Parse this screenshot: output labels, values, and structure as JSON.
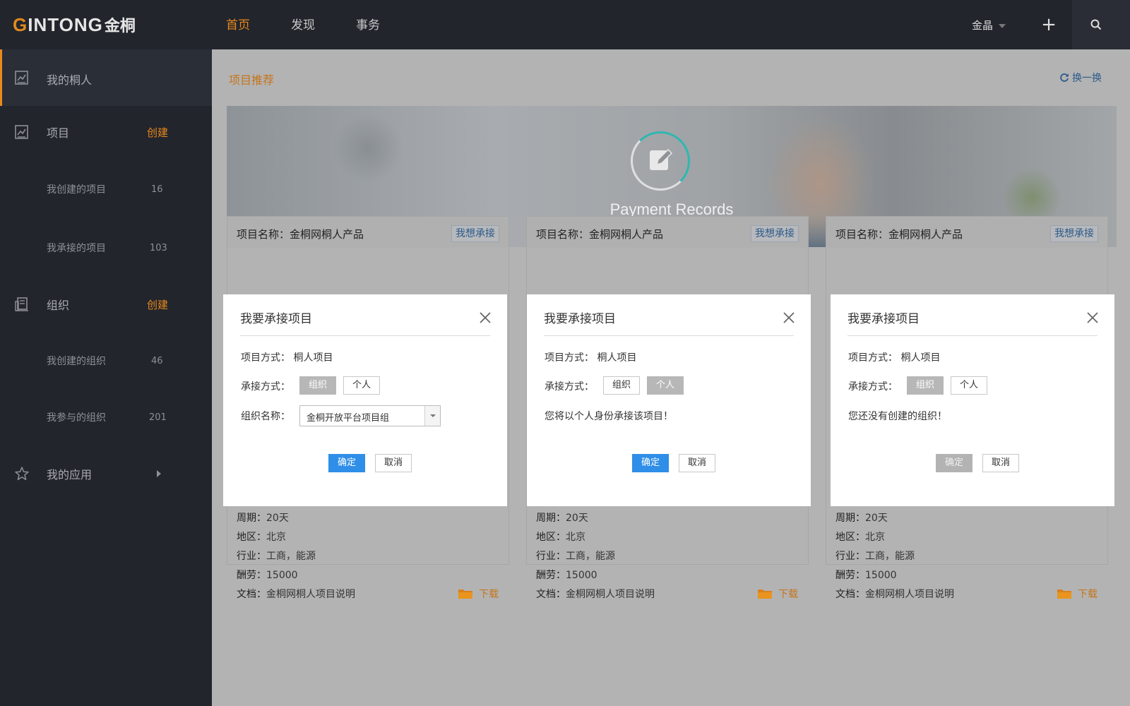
{
  "brand": {
    "logo_g": "G",
    "logo_rest": "INTONG",
    "logo_cn": "金桐"
  },
  "nav": {
    "items": [
      "首页",
      "发现",
      "事务"
    ],
    "active": 0
  },
  "user": {
    "name": "金晶"
  },
  "sidebar": {
    "top_label": "我的桐人",
    "project": {
      "label": "项目",
      "action": "创建"
    },
    "project_subs": [
      {
        "label": "我创建的项目",
        "count": "16"
      },
      {
        "label": "我承接的项目",
        "count": "103"
      }
    ],
    "org": {
      "label": "组织",
      "action": "创建"
    },
    "org_subs": [
      {
        "label": "我创建的组织",
        "count": "46"
      },
      {
        "label": "我参与的组织",
        "count": "201"
      }
    ],
    "apps_label": "我的应用"
  },
  "main": {
    "section_title": "项目推荐",
    "refresh_label": "换一换",
    "banner_text": "Payment Records"
  },
  "cards": [
    {
      "title": "项目名称：金桐网桐人产品",
      "take": "我想承接",
      "period_k": "周期：",
      "period_v": "20天",
      "region_k": "地区：",
      "region_v": "北京",
      "industry_k": "行业：",
      "industry_v": "工商，能源",
      "pay_k": "酬劳：",
      "pay_v": "15000",
      "doc_k": "文档：",
      "doc_v": "金桐网桐人项目说明",
      "download": "下载"
    },
    {
      "title": "项目名称：金桐网桐人产品",
      "take": "我想承接",
      "period_k": "周期：",
      "period_v": "20天",
      "region_k": "地区：",
      "region_v": "北京",
      "industry_k": "行业：",
      "industry_v": "工商，能源",
      "pay_k": "酬劳：",
      "pay_v": "15000",
      "doc_k": "文档：",
      "doc_v": "金桐网桐人项目说明",
      "download": "下载"
    },
    {
      "title": "项目名称：金桐网桐人产品",
      "take": "我想承接",
      "period_k": "周期：",
      "period_v": "20天",
      "region_k": "地区：",
      "region_v": "北京",
      "industry_k": "行业：",
      "industry_v": "工商，能源",
      "pay_k": "酬劳：",
      "pay_v": "15000",
      "doc_k": "文档：",
      "doc_v": "金桐网桐人项目说明",
      "download": "下载"
    }
  ],
  "dialogs": [
    {
      "title": "我要承接项目",
      "mode_label": "项目方式：",
      "mode_value": "桐人项目",
      "take_label": "承接方式：",
      "opt_org": "组织",
      "opt_person": "个人",
      "selected": "org",
      "org_name_label": "组织名称：",
      "org_name_value": "金桐开放平台项目组",
      "message": "",
      "ok": "确定",
      "cancel": "取消",
      "ok_enabled": true
    },
    {
      "title": "我要承接项目",
      "mode_label": "项目方式：",
      "mode_value": "桐人项目",
      "take_label": "承接方式：",
      "opt_org": "组织",
      "opt_person": "个人",
      "selected": "person",
      "message": "您将以个人身份承接该项目！",
      "ok": "确定",
      "cancel": "取消",
      "ok_enabled": true
    },
    {
      "title": "我要承接项目",
      "mode_label": "项目方式：",
      "mode_value": "桐人项目",
      "take_label": "承接方式：",
      "opt_org": "组织",
      "opt_person": "个人",
      "selected": "org",
      "message": "您还没有创建的组织！",
      "ok": "确定",
      "cancel": "取消",
      "ok_enabled": false
    }
  ],
  "colors": {
    "accent": "#e8891d",
    "primary_button": "#2f8ee8",
    "link": "#2c5a8a",
    "topbar": "#22252c",
    "overlay": "#b3b3b3"
  }
}
